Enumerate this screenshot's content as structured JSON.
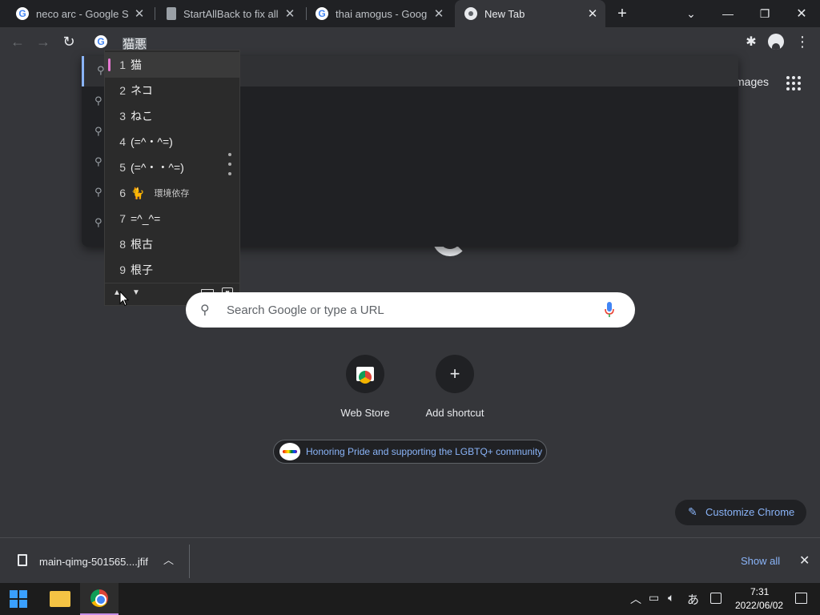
{
  "browser": {
    "tabs": [
      {
        "title": "neco arc - Google Sear",
        "favicon": "google-icon",
        "active": false
      },
      {
        "title": "StartAllBack to fix all W",
        "favicon": "document-icon",
        "active": false
      },
      {
        "title": "thai amogus - Google",
        "favicon": "google-icon",
        "active": false
      },
      {
        "title": "New Tab",
        "favicon": "chrome-icon",
        "active": true
      }
    ],
    "new_tab_symbol": "+",
    "omnibox_text": "猫悪"
  },
  "ime": {
    "candidates": [
      {
        "num": "1",
        "text": "猫",
        "note": ""
      },
      {
        "num": "2",
        "text": "ネコ",
        "note": ""
      },
      {
        "num": "3",
        "text": "ねこ",
        "note": ""
      },
      {
        "num": "4",
        "text": "(=^・^=)",
        "note": ""
      },
      {
        "num": "5",
        "text": "(=^・・^=)",
        "note": ""
      },
      {
        "num": "6",
        "text": "🐈",
        "note": "環境依存"
      },
      {
        "num": "7",
        "text": "=^_^=",
        "note": ""
      },
      {
        "num": "8",
        "text": "根古",
        "note": ""
      },
      {
        "num": "9",
        "text": "根子",
        "note": ""
      }
    ]
  },
  "ntp": {
    "images_link": "mages",
    "search_placeholder": "Search Google or type a URL",
    "shortcuts": [
      {
        "label": "Web Store"
      },
      {
        "label": "Add shortcut"
      }
    ],
    "pride_banner": "Honoring Pride and supporting the LGBTQ+ community",
    "customize_label": "Customize Chrome"
  },
  "downloads": {
    "file_name": "main-qimg-501565....jfif",
    "show_all": "Show all"
  },
  "taskbar": {
    "time": "7:31",
    "date": "2022/06/02",
    "ime_mode": "あ"
  }
}
